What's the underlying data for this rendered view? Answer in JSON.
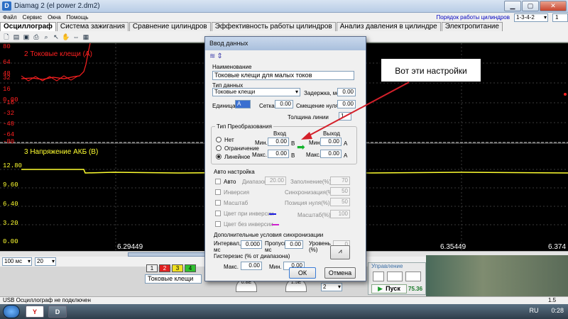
{
  "window": {
    "title": "Diamag 2 (el power 2.dm2)"
  },
  "menu": {
    "items": [
      "Файл",
      "Сервис",
      "Окна",
      "Помощь"
    ],
    "firing_order_label": "Порядок работы цилиндров",
    "firing_order_value": "1-3-4-2",
    "cylinder_value": "1"
  },
  "tabs": [
    {
      "label": "Осциллограф",
      "active": true
    },
    {
      "label": "Система зажигания"
    },
    {
      "label": "Сравнение цилиндров"
    },
    {
      "label": "Эффективность работы цилиндров"
    },
    {
      "label": "Анализ давления в цилиндре"
    },
    {
      "label": "Электропитание"
    }
  ],
  "toolbar_icons": [
    "new-icon",
    "open-icon",
    "save-icon",
    "print-icon",
    "zoom-icon",
    "cursor-icon",
    "hand-icon",
    "measure-icon",
    "grid-icon"
  ],
  "scope": {
    "channel2": {
      "title": "2 Токовые клещи (А)",
      "color": "#ff2020",
      "ticks": [
        "80",
        "64",
        "48",
        "32",
        "16",
        "0.00",
        "-16",
        "-32",
        "-48",
        "-64",
        "-80"
      ]
    },
    "channel3": {
      "title": "3 Напряжение АКБ (В)",
      "color": "#ffff30",
      "ticks": [
        "12.80",
        "9.60",
        "6.40",
        "3.20",
        "0.00"
      ]
    },
    "time_labels": [
      "6.29449",
      "6.35449",
      "6.374"
    ]
  },
  "controls": {
    "timebase": "100 мс",
    "samples": "20"
  },
  "bottom": {
    "channel_buttons": [
      "1",
      "2",
      "3",
      "4"
    ],
    "channel_name": "Токовые клещи",
    "gauge1": "0.8E",
    "gauge2": "1.5E",
    "divider_value": "2",
    "control_header": "Управление",
    "start_label": "Пуск",
    "level_value": "75.36"
  },
  "status": {
    "text": "USB Осциллограф не подключен",
    "version": "1.5"
  },
  "taskbar": {
    "lang": "RU",
    "time": "0:28"
  },
  "dialog": {
    "title": "Ввод данных",
    "name_label": "Наименование",
    "name_value": "Токовые клещи для малых токов",
    "type_label": "Тип данных",
    "type_value": "Токовые клещи",
    "delay_label": "Задержка, мс",
    "delay_value": "0.00",
    "unit_label": "Единица",
    "unit_value": "А",
    "grid_label": "Сетка",
    "grid_value": "0.00",
    "offset_label": "Смещение нуля",
    "offset_value": "0.00",
    "thickness_label": "Толщина линии",
    "thickness_value": "1",
    "transform": {
      "title": "Тип Преобразования",
      "input_label": "Вход",
      "output_label": "Выход",
      "options": [
        "Нет",
        "Ограничение",
        "Линейное"
      ],
      "selected": "Линейное",
      "min_label": "Мин.",
      "max_label": "Макс.",
      "in_min": "0.00",
      "in_max": "0.00",
      "out_min": "0.00",
      "out_max": "0.00",
      "in_unit": "В",
      "out_unit": "А"
    },
    "auto": {
      "title": "Авто настройка",
      "auto_label": "Авто",
      "range_label": "Диапазон",
      "range_value": "20.00",
      "fill_label": "Заполнение(%)",
      "fill_value": "70",
      "inversion_label": "Инверсия",
      "sync_label": "Синхронизация(%)",
      "sync_value": "50",
      "scale_label": "Масштаб",
      "zero_pos_label": "Позиция нуля(%)",
      "zero_pos_value": "50",
      "color_inv_label": "Цвет при инверсии",
      "color_inv": "#1a1ae0",
      "color_noinv_label": "Цвет без инверсии",
      "color_noinv": "#d020d0",
      "scale_pct_label": "Масштаб(%)",
      "scale_pct_value": "100"
    },
    "sync": {
      "title": "Дополнительные условия синхронизации",
      "interval_label": "Интервал, мс",
      "interval_value": "0.000",
      "skip_label": "Пропуск, мс",
      "skip_value": "0.00",
      "level_label": "Уровень (%)",
      "level_value": "0",
      "hyst_label": "Гистерезис (% от диапазона)",
      "max_label": "Макс.",
      "max_value": "0.00",
      "min_label": "Мин.",
      "min_value": "0.00"
    },
    "ok_label": "ОК",
    "cancel_label": "Отмена"
  },
  "annotation": {
    "text": "Вот эти настройки",
    "arrow_color": "#d4202a"
  }
}
